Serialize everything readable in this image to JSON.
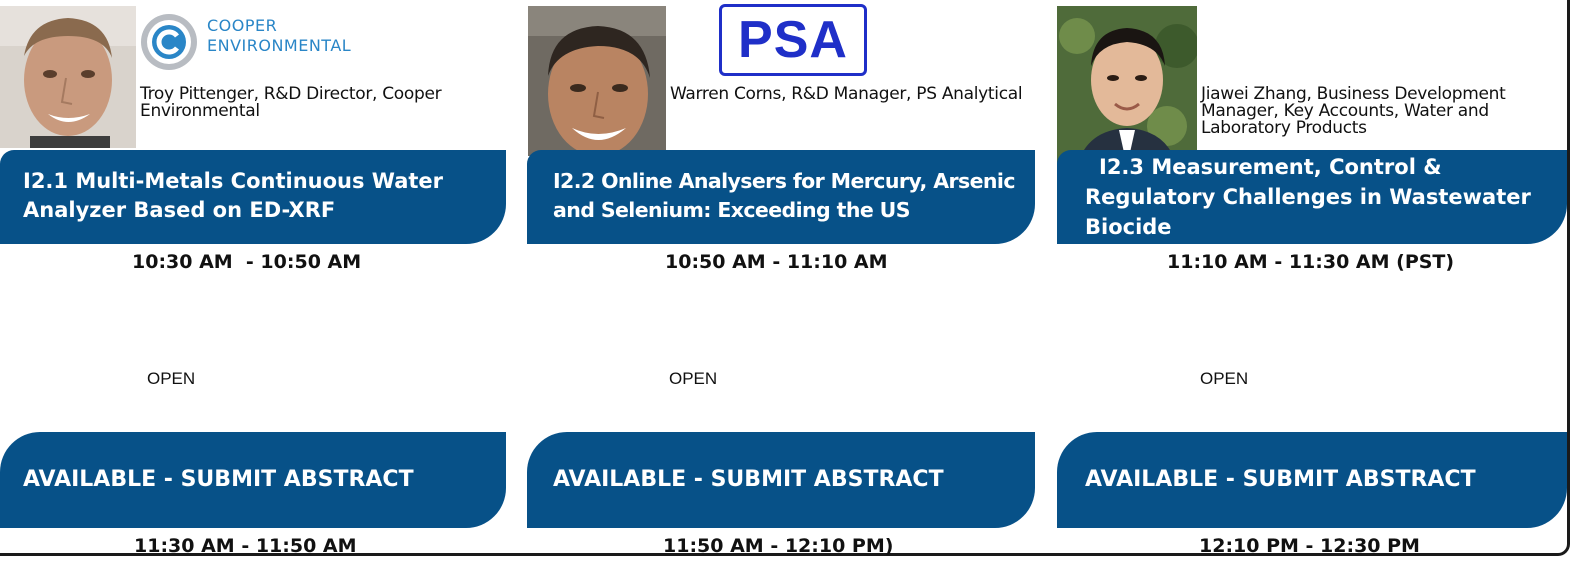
{
  "sessions": [
    {
      "speaker": "Troy Pittenger, R&D Director, Cooper Environmental",
      "logo": {
        "name": "cooper-environmental-logo",
        "line1": "COOPER",
        "line2": "ENVIRONMENTAL"
      },
      "title": "I2.1 Multi-Metals Continuous Water Analyzer Based on ED-XRF",
      "time": "10:30 AM  - 10:50 AM",
      "open_label": "OPEN",
      "available_label": "AVAILABLE - SUBMIT ABSTRACT",
      "next_time": "11:30 AM - 11:50 AM"
    },
    {
      "speaker": "Warren Corns, R&D Manager, PS Analytical",
      "logo": {
        "name": "psa-logo",
        "text": "PSA"
      },
      "title": "I2.2 Online Analysers for Mercury, Arsenic and Selenium: Exceeding the US",
      "time": "10:50 AM - 11:10 AM",
      "open_label": "OPEN",
      "available_label": "AVAILABLE - SUBMIT ABSTRACT",
      "next_time": "11:50 AM - 12:10 PM)"
    },
    {
      "speaker": "Jiawei Zhang, Business Development Manager, Key Accounts, Water and Laboratory Products",
      "title_line1": "I2.3 Measurement, Control &",
      "title_rest": "Regulatory Challenges in Wastewater Biocide",
      "time": "11:10 AM - 11:30 AM (PST)",
      "open_label": "OPEN",
      "available_label": "AVAILABLE - SUBMIT ABSTRACT",
      "next_time": "12:10 PM - 12:30 PM"
    }
  ],
  "colors": {
    "band": "#075188",
    "psa_blue": "#1f2fc8",
    "cooper_blue": "#2a86c7"
  }
}
